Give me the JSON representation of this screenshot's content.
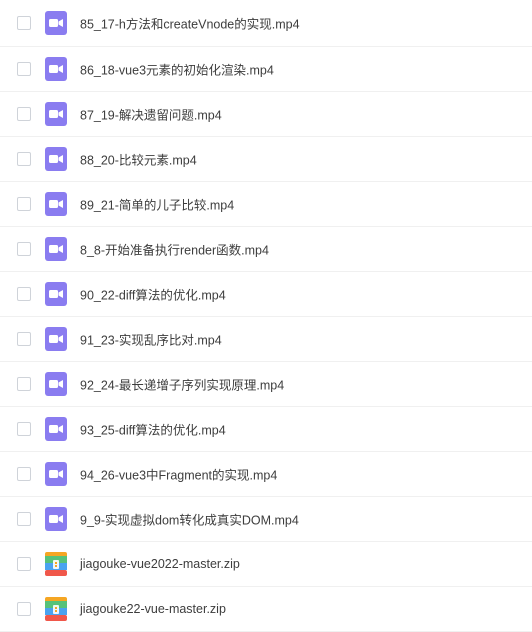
{
  "files": [
    {
      "name": "85_17-h方法和createVnode的实现.mp4",
      "type": "video"
    },
    {
      "name": "86_18-vue3元素的初始化渲染.mp4",
      "type": "video"
    },
    {
      "name": "87_19-解决遗留问题.mp4",
      "type": "video"
    },
    {
      "name": "88_20-比较元素.mp4",
      "type": "video"
    },
    {
      "name": "89_21-简单的儿子比较.mp4",
      "type": "video"
    },
    {
      "name": "8_8-开始准备执行render函数.mp4",
      "type": "video"
    },
    {
      "name": "90_22-diff算法的优化.mp4",
      "type": "video"
    },
    {
      "name": "91_23-实现乱序比对.mp4",
      "type": "video"
    },
    {
      "name": "92_24-最长递增子序列实现原理.mp4",
      "type": "video"
    },
    {
      "name": "93_25-diff算法的优化.mp4",
      "type": "video"
    },
    {
      "name": "94_26-vue3中Fragment的实现.mp4",
      "type": "video"
    },
    {
      "name": "9_9-实现虚拟dom转化成真实DOM.mp4",
      "type": "video"
    },
    {
      "name": "jiagouke-vue2022-master.zip",
      "type": "zip"
    },
    {
      "name": "jiagouke22-vue-master.zip",
      "type": "zip"
    }
  ],
  "colors": {
    "video_icon": "#8a7cf0",
    "zip_top": "#f5a623",
    "zip_green": "#57c27a",
    "zip_blue": "#4aa3f0",
    "zip_red": "#f0574a"
  }
}
